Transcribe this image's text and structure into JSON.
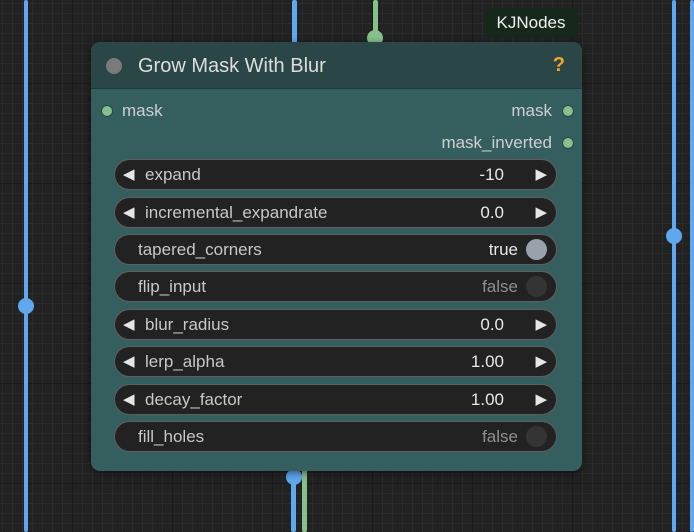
{
  "badge": {
    "label": "KJNodes"
  },
  "node": {
    "title": "Grow Mask With Blur",
    "help_glyph": "?",
    "inputs": [
      {
        "label": "mask"
      }
    ],
    "outputs": [
      {
        "label": "mask"
      },
      {
        "label": "mask_inverted"
      }
    ],
    "widgets": [
      {
        "label": "expand",
        "value": "-10",
        "kind": "number"
      },
      {
        "label": "incremental_expandrate",
        "value": "0.0",
        "kind": "number"
      },
      {
        "label": "tapered_corners",
        "value": "true",
        "kind": "toggle"
      },
      {
        "label": "flip_input",
        "value": "false",
        "kind": "toggle"
      },
      {
        "label": "blur_radius",
        "value": "0.0",
        "kind": "number"
      },
      {
        "label": "lerp_alpha",
        "value": "1.00",
        "kind": "number"
      },
      {
        "label": "decay_factor",
        "value": "1.00",
        "kind": "number"
      },
      {
        "label": "fill_holes",
        "value": "false",
        "kind": "toggle"
      }
    ]
  },
  "arrows": {
    "left": "◀",
    "right": "▶"
  },
  "colors": {
    "canvas": "#222222",
    "node_body": "#355e5e",
    "node_header": "#2a4646",
    "wire_mask": "#5fa8f0",
    "wire_image": "#86c08a",
    "help": "#f2a52a",
    "slot": "#86c08a"
  },
  "icons": {
    "collapse": "collapse-dot-icon",
    "help": "question-mark-icon",
    "decrement": "triangle-left-icon",
    "increment": "triangle-right-icon"
  }
}
